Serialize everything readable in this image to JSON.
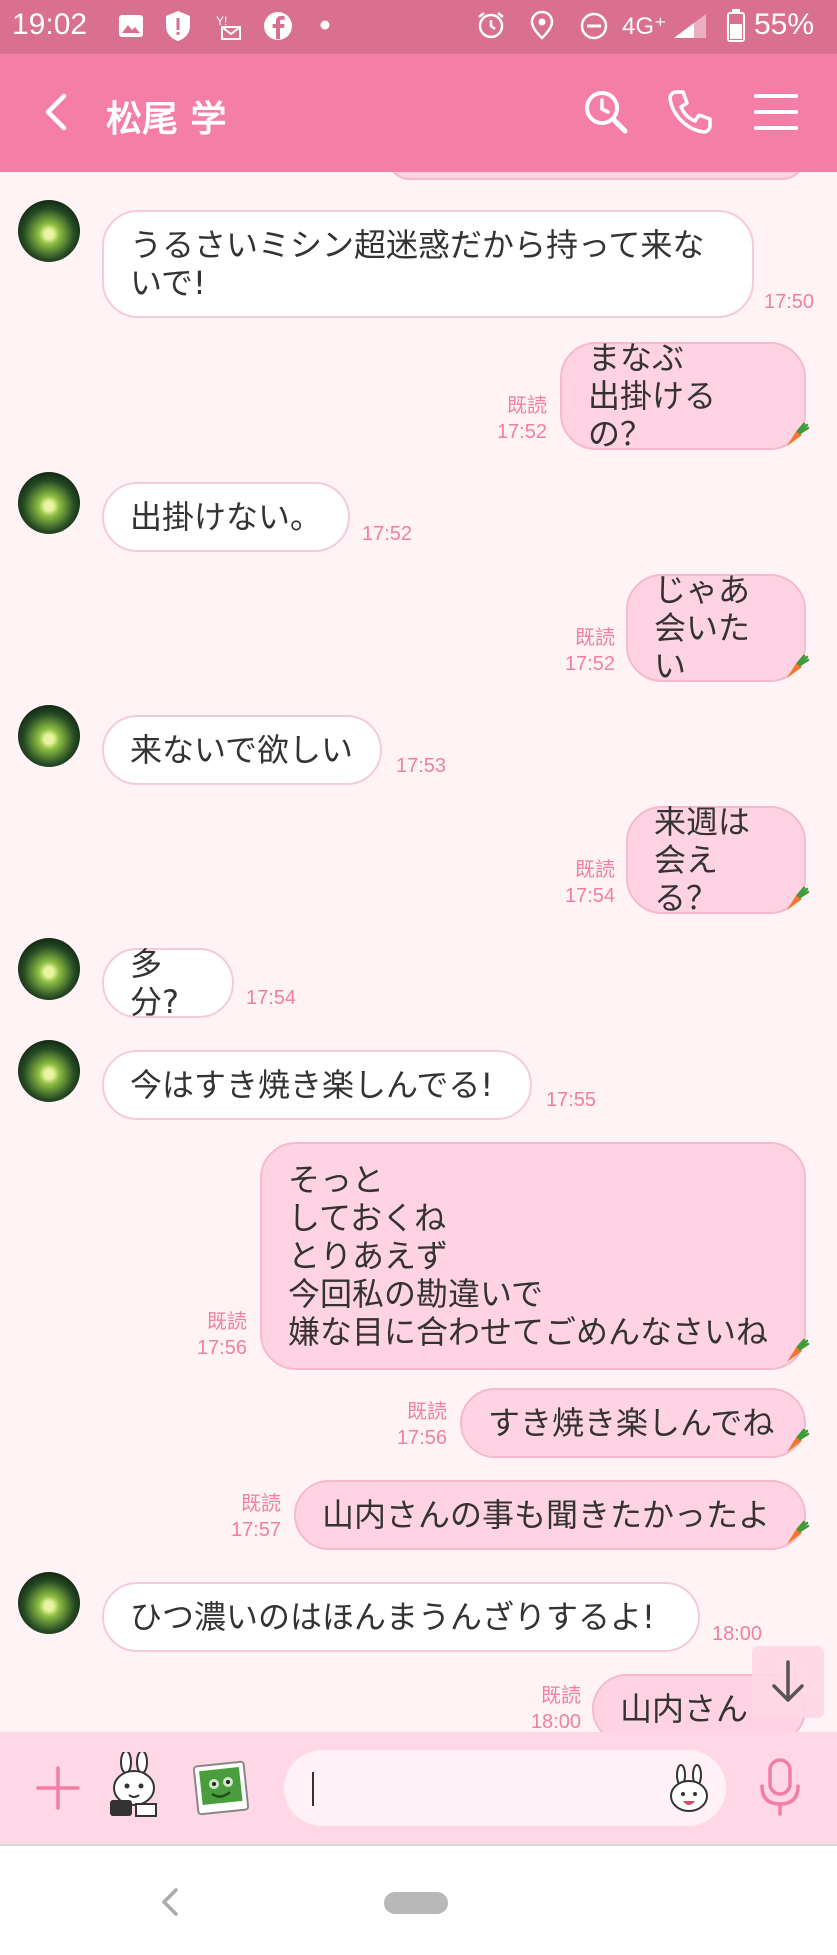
{
  "status_bar": {
    "time": "19:02",
    "network": "4G⁺",
    "battery": "55%"
  },
  "header": {
    "back_icon": "chevron-left-icon",
    "title": "松尾 学",
    "search_icon": "search-icon",
    "call_icon": "phone-icon",
    "menu_icon": "menu-icon"
  },
  "messages": [
    {
      "side": "left",
      "text": "うるさいミシン超迷惑だから持って来な\nいで!",
      "time": "17:50"
    },
    {
      "side": "right",
      "text": "まなぶ\n出掛けるの？",
      "read": "既読",
      "time": "17:52"
    },
    {
      "side": "left",
      "text": "出掛けない。",
      "time": "17:52"
    },
    {
      "side": "right",
      "text": "じゃあ\n会いたい",
      "read": "既読",
      "time": "17:52"
    },
    {
      "side": "left",
      "text": "来ないで欲しい",
      "time": "17:53"
    },
    {
      "side": "right",
      "text": "来週は\n会える？",
      "read": "既読",
      "time": "17:54"
    },
    {
      "side": "left",
      "text": "多分?",
      "time": "17:54"
    },
    {
      "side": "left",
      "text": "今はすき焼き楽しんでる!",
      "time": "17:55"
    },
    {
      "side": "right",
      "text": "そっと\nしておくね\nとりあえず\n今回私の勘違いで\n嫌な目に合わせてごめんなさいね",
      "read": "既読",
      "time": "17:56"
    },
    {
      "side": "right",
      "text": "すき焼き楽しんでね",
      "read": "既読",
      "time": "17:56"
    },
    {
      "side": "right",
      "text": "山内さんの事も聞きたかったよ",
      "read": "既読",
      "time": "17:57"
    },
    {
      "side": "left",
      "text": "ひつ濃いのはほんまうんざりするよ!",
      "time": "18:00"
    },
    {
      "side": "right",
      "text": "山内さん",
      "read": "既読",
      "time": "18:00"
    }
  ],
  "input_bar": {
    "plus_icon": "plus-icon",
    "sticker_icon": "sticker-icon",
    "photo_icon": "photo-icon",
    "emoji_icon": "emoji-icon",
    "mic_icon": "microphone-icon"
  },
  "colors": {
    "header": "#f57ea7",
    "status_bar": "#d9708f",
    "chat_bg": "#fff3f6",
    "bubble_mine": "#ffd3e3",
    "accent_text": "#f27fa2"
  }
}
